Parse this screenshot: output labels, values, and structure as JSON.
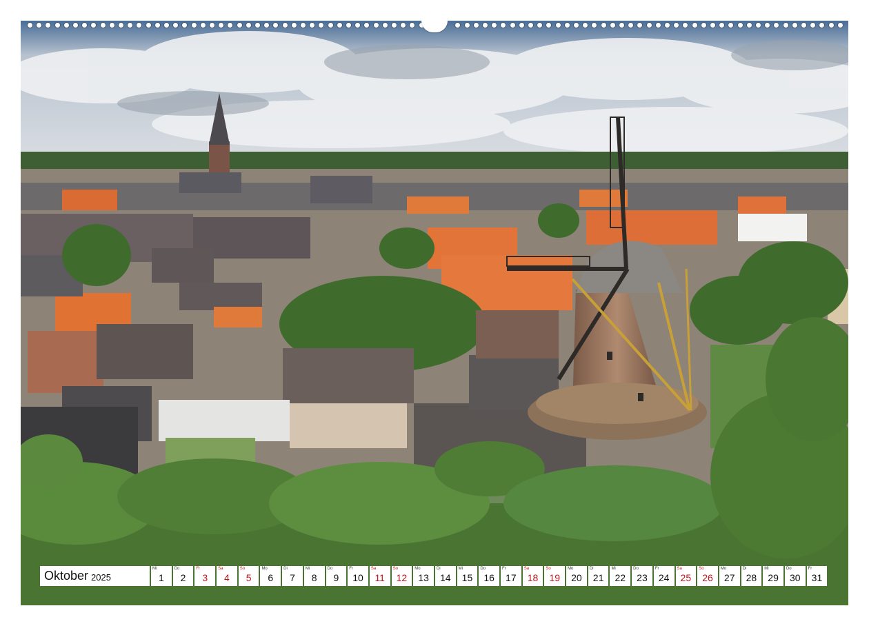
{
  "calendar": {
    "month": "Oktober",
    "year": "2025",
    "days": [
      {
        "wd": "Mi",
        "num": "1",
        "red": false
      },
      {
        "wd": "Do",
        "num": "2",
        "red": false
      },
      {
        "wd": "Fr",
        "num": "3",
        "red": true
      },
      {
        "wd": "Sa",
        "num": "4",
        "red": true
      },
      {
        "wd": "So",
        "num": "5",
        "red": true
      },
      {
        "wd": "Mo",
        "num": "6",
        "red": false
      },
      {
        "wd": "Di",
        "num": "7",
        "red": false
      },
      {
        "wd": "Mi",
        "num": "8",
        "red": false
      },
      {
        "wd": "Do",
        "num": "9",
        "red": false
      },
      {
        "wd": "Fr",
        "num": "10",
        "red": false
      },
      {
        "wd": "Sa",
        "num": "11",
        "red": true
      },
      {
        "wd": "So",
        "num": "12",
        "red": true
      },
      {
        "wd": "Mo",
        "num": "13",
        "red": false
      },
      {
        "wd": "Di",
        "num": "14",
        "red": false
      },
      {
        "wd": "Mi",
        "num": "15",
        "red": false
      },
      {
        "wd": "Do",
        "num": "16",
        "red": false
      },
      {
        "wd": "Fr",
        "num": "17",
        "red": false
      },
      {
        "wd": "Sa",
        "num": "18",
        "red": true
      },
      {
        "wd": "So",
        "num": "19",
        "red": true
      },
      {
        "wd": "Mo",
        "num": "20",
        "red": false
      },
      {
        "wd": "Di",
        "num": "21",
        "red": false
      },
      {
        "wd": "Mi",
        "num": "22",
        "red": false
      },
      {
        "wd": "Do",
        "num": "23",
        "red": false
      },
      {
        "wd": "Fr",
        "num": "24",
        "red": false
      },
      {
        "wd": "Sa",
        "num": "25",
        "red": true
      },
      {
        "wd": "So",
        "num": "26",
        "red": true
      },
      {
        "wd": "Mo",
        "num": "27",
        "red": false
      },
      {
        "wd": "Di",
        "num": "28",
        "red": false
      },
      {
        "wd": "Mi",
        "num": "29",
        "red": false
      },
      {
        "wd": "Do",
        "num": "30",
        "red": false
      },
      {
        "wd": "Fr",
        "num": "31",
        "red": false
      }
    ]
  },
  "colors": {
    "holiday": "#c0141b",
    "sky": "#c9d2dc",
    "roof_orange": "#e0713a",
    "foliage": "#4f7a34"
  }
}
